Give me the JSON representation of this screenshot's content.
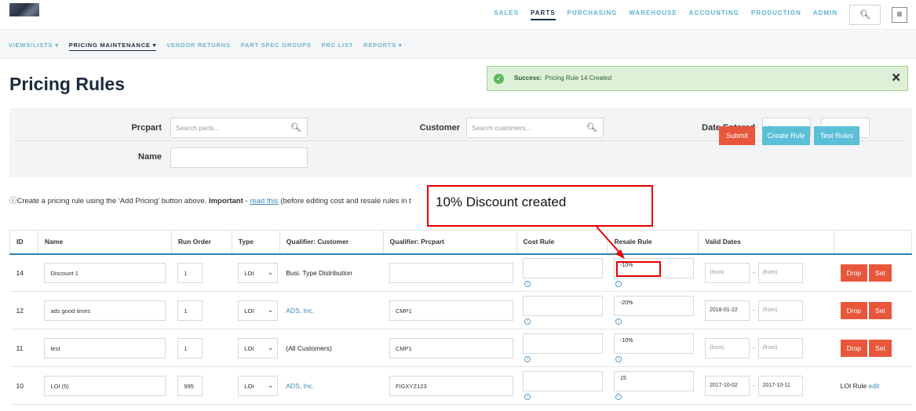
{
  "topnav": [
    "SALES",
    "PARTS",
    "PURCHASING",
    "WAREHOUSE",
    "ACCOUNTING",
    "PRODUCTION",
    "ADMIN"
  ],
  "topnav_active": "PARTS",
  "subnav": [
    "VIEWS/LISTS ▾",
    "PRICING MAINTENANCE ▾",
    "VENDOR RETURNS",
    "PART SPEC GROUPS",
    "PRC LIST",
    "REPORTS ▾"
  ],
  "subnav_active": "PRICING MAINTENANCE ▾",
  "page_title": "Pricing Rules",
  "alert": {
    "label": "Success:",
    "message": "Pricing Rule 14 Created",
    "close": "✕"
  },
  "filter": {
    "prcpart_label": "Prcpart",
    "prcpart_placeholder": "Search parts...",
    "customer_label": "Customer",
    "customer_placeholder": "Search customers...",
    "date_label": "Date Entered",
    "date_from": "(from)",
    "date_to": "(to)",
    "name_label": "Name",
    "submit": "Submit",
    "create_rule": "Create Rule",
    "test_rules": "Test Rules"
  },
  "info": {
    "icon": "ⓘ",
    "text1": "Create a pricing rule using the 'Add Pricing' button above. ",
    "important": "Important",
    "text2": " - ",
    "link": "read this",
    "text3": " (before editing cost and resale rules in t"
  },
  "annotation": "10% Discount created",
  "table": {
    "headers": [
      "ID",
      "Name",
      "Run Order",
      "Type",
      "Qualifier: Customer",
      "Qualifier: Prcpart",
      "Cost Rule",
      "Resale Rule",
      "Valid Dates",
      ""
    ],
    "rows": [
      {
        "id": "14",
        "name": "Discount 1",
        "order": "1",
        "type": "LOI",
        "customer": "Busi. Type Distribution",
        "customer_link": false,
        "prcpart": "",
        "cost": "",
        "resale": "-10%",
        "from": "(from)",
        "to": "(from)",
        "from_filled": false,
        "to_filled": false,
        "action": "buttons",
        "drop": "Drop",
        "set": "Set"
      },
      {
        "id": "12",
        "name": "ads good times",
        "order": "1",
        "type": "LOI",
        "customer": "ADS, Inc.",
        "customer_link": true,
        "prcpart": "CMP1",
        "cost": "",
        "resale": "-20%",
        "from": "2018-01-22",
        "to": "(from)",
        "from_filled": true,
        "to_filled": false,
        "action": "buttons",
        "drop": "Drop",
        "set": "Set"
      },
      {
        "id": "11",
        "name": "test",
        "order": "1",
        "type": "LOI",
        "customer": "(All Customers)",
        "customer_link": false,
        "prcpart": "CMP1",
        "cost": "",
        "resale": "-10%",
        "from": "(from)",
        "to": "(from)",
        "from_filled": false,
        "to_filled": false,
        "action": "buttons",
        "drop": "Drop",
        "set": "Set"
      },
      {
        "id": "10",
        "name": "LOI (5)",
        "order": "995",
        "type": "LOI",
        "customer": "ADS, Inc.",
        "customer_link": true,
        "prcpart": "FIGXYZ123",
        "cost": "",
        "resale": "15",
        "from": "2017-10-02",
        "to": "2017-10-11",
        "from_filled": true,
        "to_filled": true,
        "action": "text",
        "action_label": "LOI Rule",
        "action_link": "edit"
      }
    ]
  },
  "icons": {
    "search": "⚲",
    "menu": "≡",
    "check": "✓",
    "info": "ⓘ",
    "chevron": "⌄"
  },
  "colors": {
    "accent": "#5fb4cf",
    "primary_button": "#e8573c",
    "secondary_button": "#5bbfd8",
    "success_bg": "#dff0d8",
    "annotation": "#e60000"
  }
}
